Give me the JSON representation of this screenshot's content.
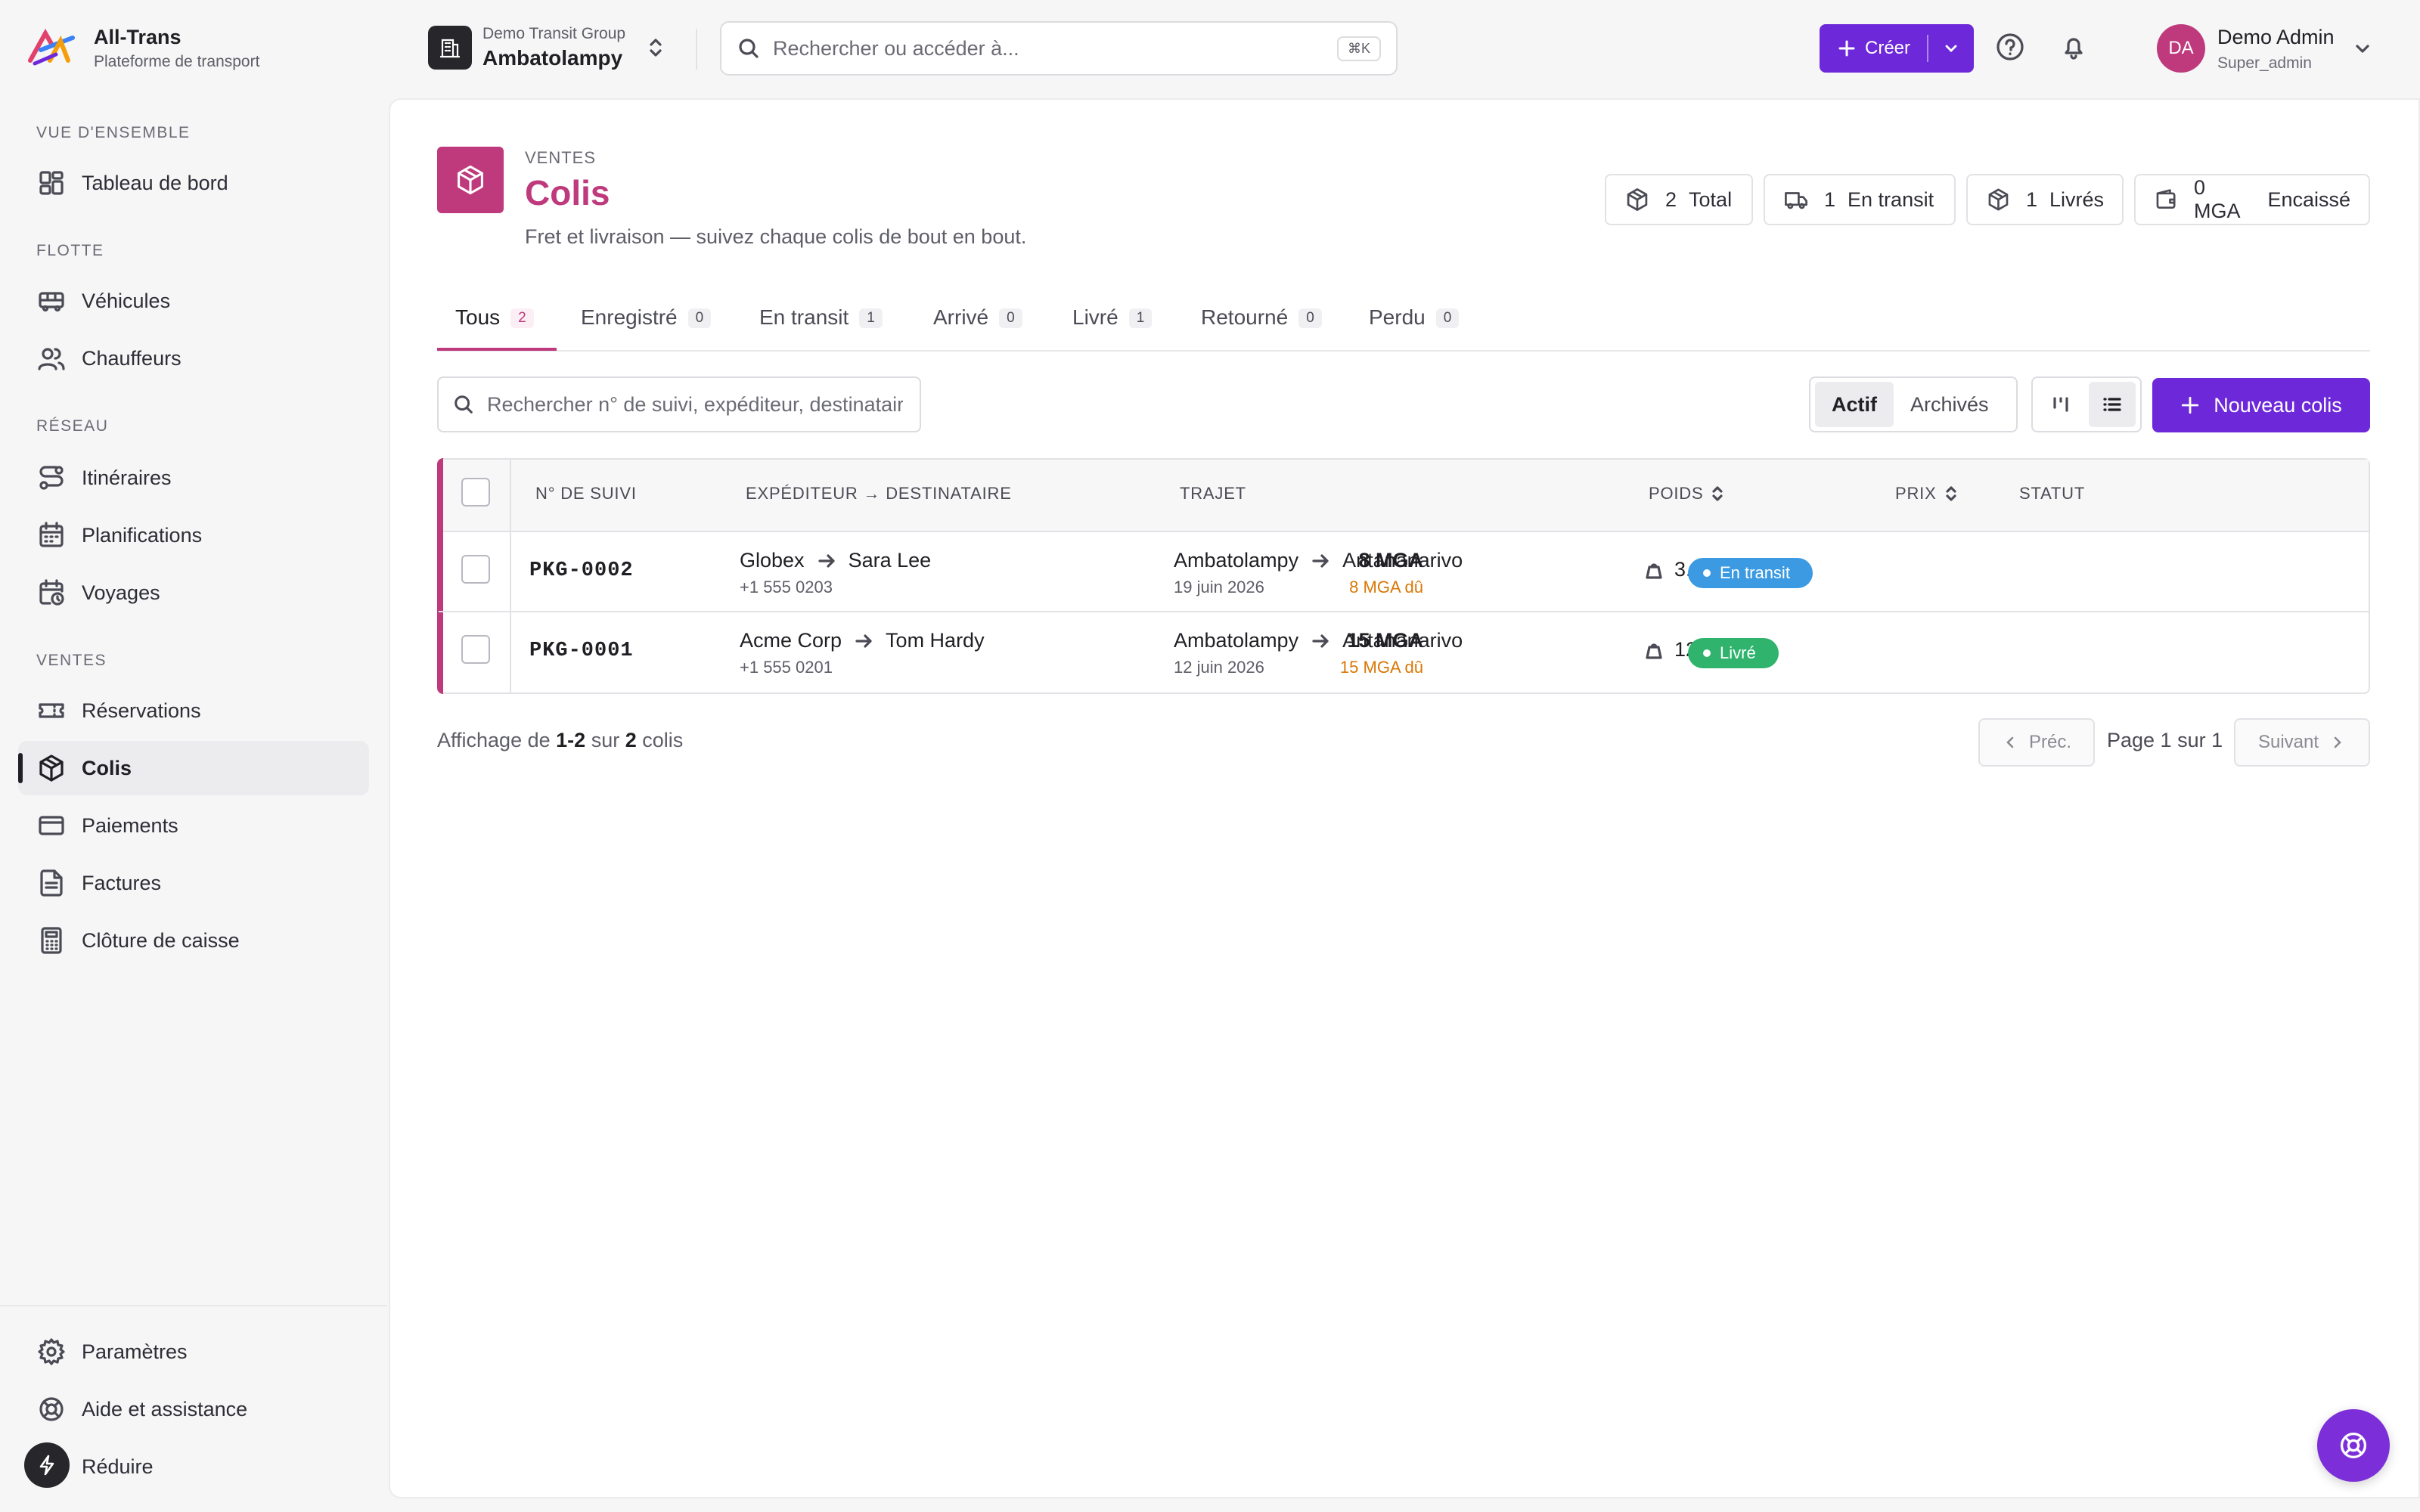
{
  "app": {
    "name": "All-Trans",
    "subtitle": "Plateforme de transport"
  },
  "sidebar": {
    "sections": [
      {
        "label": "VUE D'ENSEMBLE"
      },
      {
        "label": "FLOTTE"
      },
      {
        "label": "RÉSEAU"
      },
      {
        "label": "VENTES"
      }
    ],
    "items": [
      {
        "label": "Tableau de bord",
        "icon": "dashboard-icon"
      },
      {
        "label": "Véhicules",
        "icon": "bus-icon"
      },
      {
        "label": "Chauffeurs",
        "icon": "users-icon"
      },
      {
        "label": "Itinéraires",
        "icon": "route-icon"
      },
      {
        "label": "Planifications",
        "icon": "calendar-icon"
      },
      {
        "label": "Voyages",
        "icon": "calendar-clock-icon"
      },
      {
        "label": "Réservations",
        "icon": "ticket-icon"
      },
      {
        "label": "Colis",
        "icon": "package-icon",
        "active": true
      },
      {
        "label": "Paiements",
        "icon": "credit-card-icon"
      },
      {
        "label": "Factures",
        "icon": "file-text-icon"
      },
      {
        "label": "Clôture de caisse",
        "icon": "calculator-icon"
      }
    ],
    "bottom": [
      {
        "label": "Paramètres",
        "icon": "gear-icon"
      },
      {
        "label": "Aide et assistance",
        "icon": "lifebuoy-icon"
      },
      {
        "label": "Réduire",
        "icon": "bolt-icon"
      }
    ]
  },
  "topbar": {
    "org_group": "Demo Transit Group",
    "org_name": "Ambatolampy",
    "search_placeholder": "Rechercher ou accéder à...",
    "search_shortcut": "⌘K",
    "create_label": "Créer",
    "user": {
      "initials": "DA",
      "name": "Demo Admin",
      "role": "Super_admin"
    }
  },
  "page": {
    "section": "VENTES",
    "title": "Colis",
    "subtitle": "Fret et livraison — suivez chaque colis de bout en bout.",
    "stats": [
      {
        "value": "2",
        "label": "Total",
        "icon": "package-icon"
      },
      {
        "value": "1",
        "label": "En transit",
        "icon": "truck-icon"
      },
      {
        "value": "1",
        "label": "Livrés",
        "icon": "package-icon"
      },
      {
        "value": "0 MGA",
        "label": "Encaissé",
        "icon": "wallet-icon"
      }
    ],
    "tabs": [
      {
        "label": "Tous",
        "count": "2",
        "active": true
      },
      {
        "label": "Enregistré",
        "count": "0"
      },
      {
        "label": "En transit",
        "count": "1"
      },
      {
        "label": "Arrivé",
        "count": "0"
      },
      {
        "label": "Livré",
        "count": "1"
      },
      {
        "label": "Retourné",
        "count": "0"
      },
      {
        "label": "Perdu",
        "count": "0"
      }
    ],
    "list_search_placeholder": "Rechercher n° de suivi, expéditeur, destinataire",
    "filter": {
      "active": "Actif",
      "archived": "Archivés"
    },
    "new_button": "Nouveau colis"
  },
  "table": {
    "columns": [
      "N° DE SUIVI",
      "EXPÉDITEUR → DESTINATAIRE",
      "TRAJET",
      "POIDS",
      "PRIX",
      "STATUT"
    ],
    "rows": [
      {
        "tracking": "PKG-0002",
        "sender": "Globex",
        "recipient": "Sara Lee",
        "phone": "+1 555 0203",
        "from": "Ambatolampy",
        "to": "Antananarivo",
        "date": "19 juin 2026",
        "weight": "3.2 kg",
        "price": "8 MGA",
        "due": "8 MGA dû",
        "status": "En transit",
        "status_color": "#3b9ae1"
      },
      {
        "tracking": "PKG-0001",
        "sender": "Acme Corp",
        "recipient": "Tom Hardy",
        "phone": "+1 555 0201",
        "from": "Ambatolampy",
        "to": "Antananarivo",
        "date": "12 juin 2026",
        "weight": "12.5 kg",
        "price": "15 MGA",
        "due": "15 MGA dû",
        "status": "Livré",
        "status_color": "#2fb36d"
      }
    ]
  },
  "pagination": {
    "showing_prefix": "Affichage de",
    "range": "1-2",
    "of": "sur",
    "total": "2",
    "unit": "colis",
    "prev": "Préc.",
    "page_info": "Page 1 sur 1",
    "next": "Suivant"
  },
  "colors": {
    "accent": "#be3a7c",
    "primary": "#6d28d9"
  }
}
